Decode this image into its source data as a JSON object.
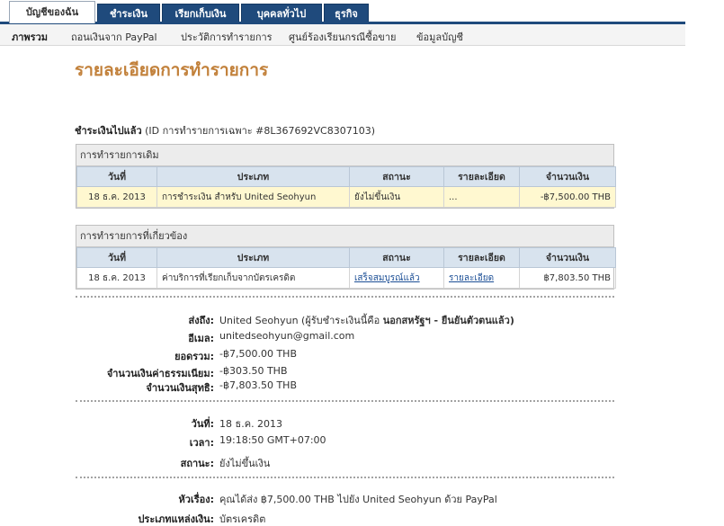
{
  "tabs": [
    {
      "label": "บัญชีของฉัน",
      "active": true
    },
    {
      "label": "ชำระเงิน"
    },
    {
      "label": "เรียกเก็บเงิน"
    },
    {
      "label": "บุคคลทั่วไป"
    },
    {
      "label": "ธุรกิจ"
    }
  ],
  "subnav": [
    "ภาพรวม",
    "ถอนเงินจาก PayPal",
    "ประวัติการทำรายการ",
    "ศูนย์ร้องเรียนกรณีซื้อขาย",
    "ข้อมูลบัญชี"
  ],
  "page_title": "รายละเอียดการทำรายการ",
  "paid": {
    "label": "ชำระเงินไปแล้ว",
    "id_text": "(ID การทำรายการเฉพาะ #8L367692VC8307103)"
  },
  "original": {
    "heading": "การทำรายการเดิม",
    "columns": [
      "วันที่",
      "ประเภท",
      "สถานะ",
      "รายละเอียด",
      "จำนวนเงิน"
    ],
    "row": [
      "18 ธ.ค. 2013",
      "การชำระเงิน สำหรับ United Seohyun",
      "ยังไม่ขึ้นเงิน",
      "...",
      "-฿7,500.00 THB"
    ]
  },
  "related": {
    "heading": "การทำรายการที่เกี่ยวข้อง",
    "columns": [
      "วันที่",
      "ประเภท",
      "สถานะ",
      "รายละเอียด",
      "จำนวนเงิน"
    ],
    "row": [
      "18 ธ.ค. 2013",
      "ค่าบริการที่เรียกเก็บจากบัตรเครดิต",
      "เสร็จสมบูรณ์แล้ว",
      "รายละเอียด",
      "฿7,803.50 THB"
    ]
  },
  "details1": {
    "to_label": "ส่งถึง:",
    "to_value": "United Seohyun (ผู้รับชำระเงินนี้คือ",
    "to_status": "นอกสหรัฐฯ - ยืนยันตัวตนแล้ว)",
    "email_label": "อีเมล:",
    "email_value": "unitedseohyun@gmail.com",
    "total_label": "ยอดรวม:",
    "total_value": "-฿7,500.00 THB",
    "fee_label": "จำนวนเงินค่าธรรมเนียม:",
    "fee_value": "-฿303.50 THB",
    "net_label": "จำนวนเงินสุทธิ:",
    "net_value": "-฿7,803.50 THB"
  },
  "details2": {
    "date_label": "วันที่:",
    "date_value": "18 ธ.ค. 2013",
    "time_label": "เวลา:",
    "time_value": "19:18:50 GMT+07:00",
    "status_label": "สถานะ:",
    "status_value": "ยังไม่ขึ้นเงิน"
  },
  "details3": {
    "subject_label": "หัวเรื่อง:",
    "subject_value": "คุณได้ส่ง ฿7,500.00 THB ไปยัง United Seohyun ด้วย PayPal",
    "source_label": "ประเภทแหล่งเงิน:",
    "source_value": "บัตรเครดิต"
  }
}
